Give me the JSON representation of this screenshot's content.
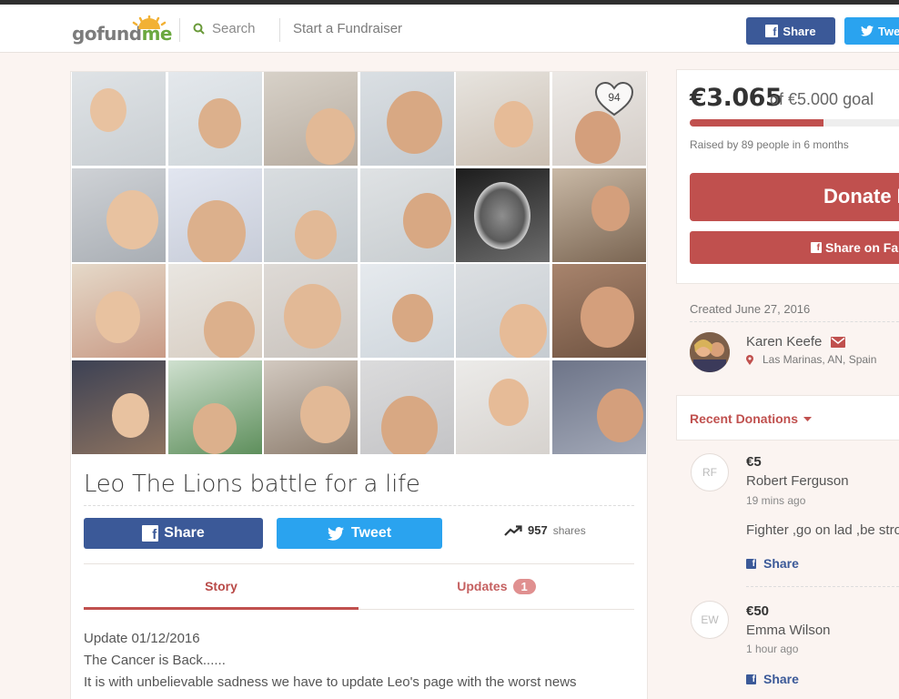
{
  "header": {
    "logo_go": "go",
    "logo_fund": "fund",
    "logo_me": "me",
    "search_label": "Search",
    "start_label": "Start a Fundraiser",
    "share_label": "Share",
    "tweet_label": "Twe"
  },
  "campaign": {
    "hearts": "94",
    "title": "Leo The Lions battle for a life",
    "share_label": "Share",
    "tweet_label": "Tweet",
    "shares_count": "957",
    "shares_label": "shares",
    "tabs": {
      "story": "Story",
      "updates": "Updates",
      "updates_badge": "1"
    },
    "story_lines": [
      "Update 01/12/2016",
      "The Cancer is Back......",
      "It is with unbelievable sadness we have to update  Leo's page with the worst news"
    ]
  },
  "progress": {
    "amount": "€3.065",
    "goal_text": "of €5.000 goal",
    "fraction": 0.613,
    "raised_text": "Raised by 89 people in 6 months",
    "donate_label": "Donate N",
    "share_fb_label": "Share on Fa"
  },
  "organizer": {
    "created": "Created June 27, 2016",
    "name": "Karen Keefe",
    "location": "Las Marinas, AN, Spain"
  },
  "donations": {
    "header": "Recent Donations",
    "items": [
      {
        "initials": "RF",
        "amount": "€5",
        "name": "Robert Ferguson",
        "time": "19 mins ago",
        "message": "Fighter ,go on lad ,be stro",
        "share": "Share"
      },
      {
        "initials": "EW",
        "amount": "€50",
        "name": "Emma Wilson",
        "time": "1 hour ago",
        "message": "",
        "share": "Share"
      }
    ]
  },
  "colors": {
    "brand_red": "#c0504e",
    "facebook": "#3b5998",
    "twitter": "#2aa3ef",
    "logo_green": "#6aa83f"
  }
}
